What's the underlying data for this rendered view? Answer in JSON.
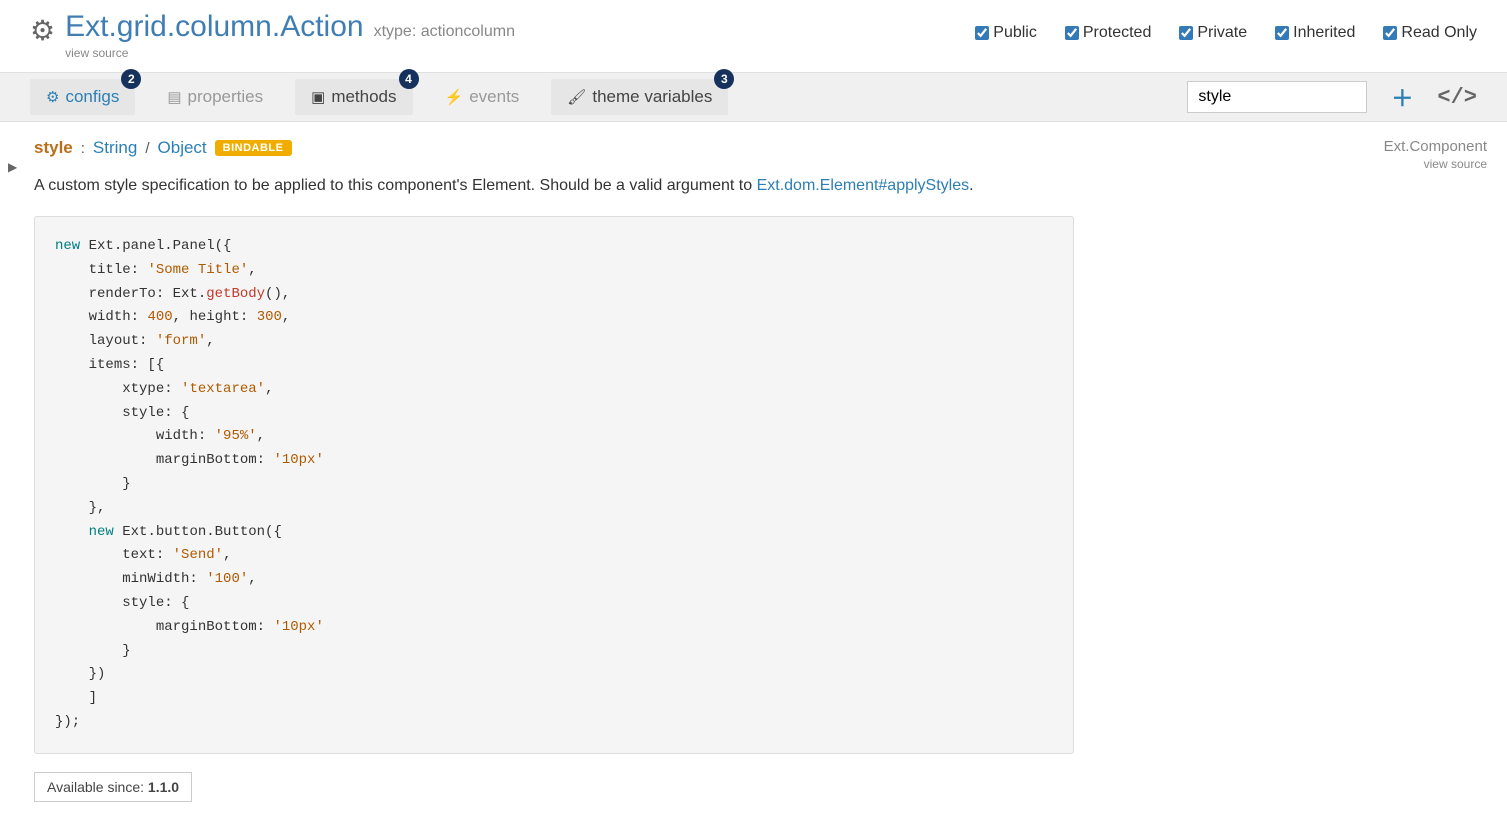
{
  "header": {
    "class_title": "Ext.grid.column.Action",
    "xtype": "xtype: actioncolumn",
    "view_source": "view source"
  },
  "checks": {
    "public": "Public",
    "protected": "Protected",
    "private": "Private",
    "inherited": "Inherited",
    "readonly": "Read Only"
  },
  "tabs": {
    "configs": {
      "label": "configs",
      "badge": "2"
    },
    "properties": {
      "label": "properties"
    },
    "methods": {
      "label": "methods",
      "badge": "4"
    },
    "events": {
      "label": "events"
    },
    "theme": {
      "label": "theme variables",
      "badge": "3"
    }
  },
  "search": {
    "value": "style"
  },
  "member": {
    "name": "style",
    "type1": "String",
    "type2": "Object",
    "tag": "BINDABLE",
    "origin_class": "Ext.Component",
    "origin_link": "view source"
  },
  "description": {
    "text_before": "A custom style specification to be applied to this component's Element. Should be a valid argument to ",
    "link": "Ext.dom.Element#applyStyles",
    "text_after": "."
  },
  "since": {
    "label": "Available since: ",
    "version": "1.1.0"
  }
}
